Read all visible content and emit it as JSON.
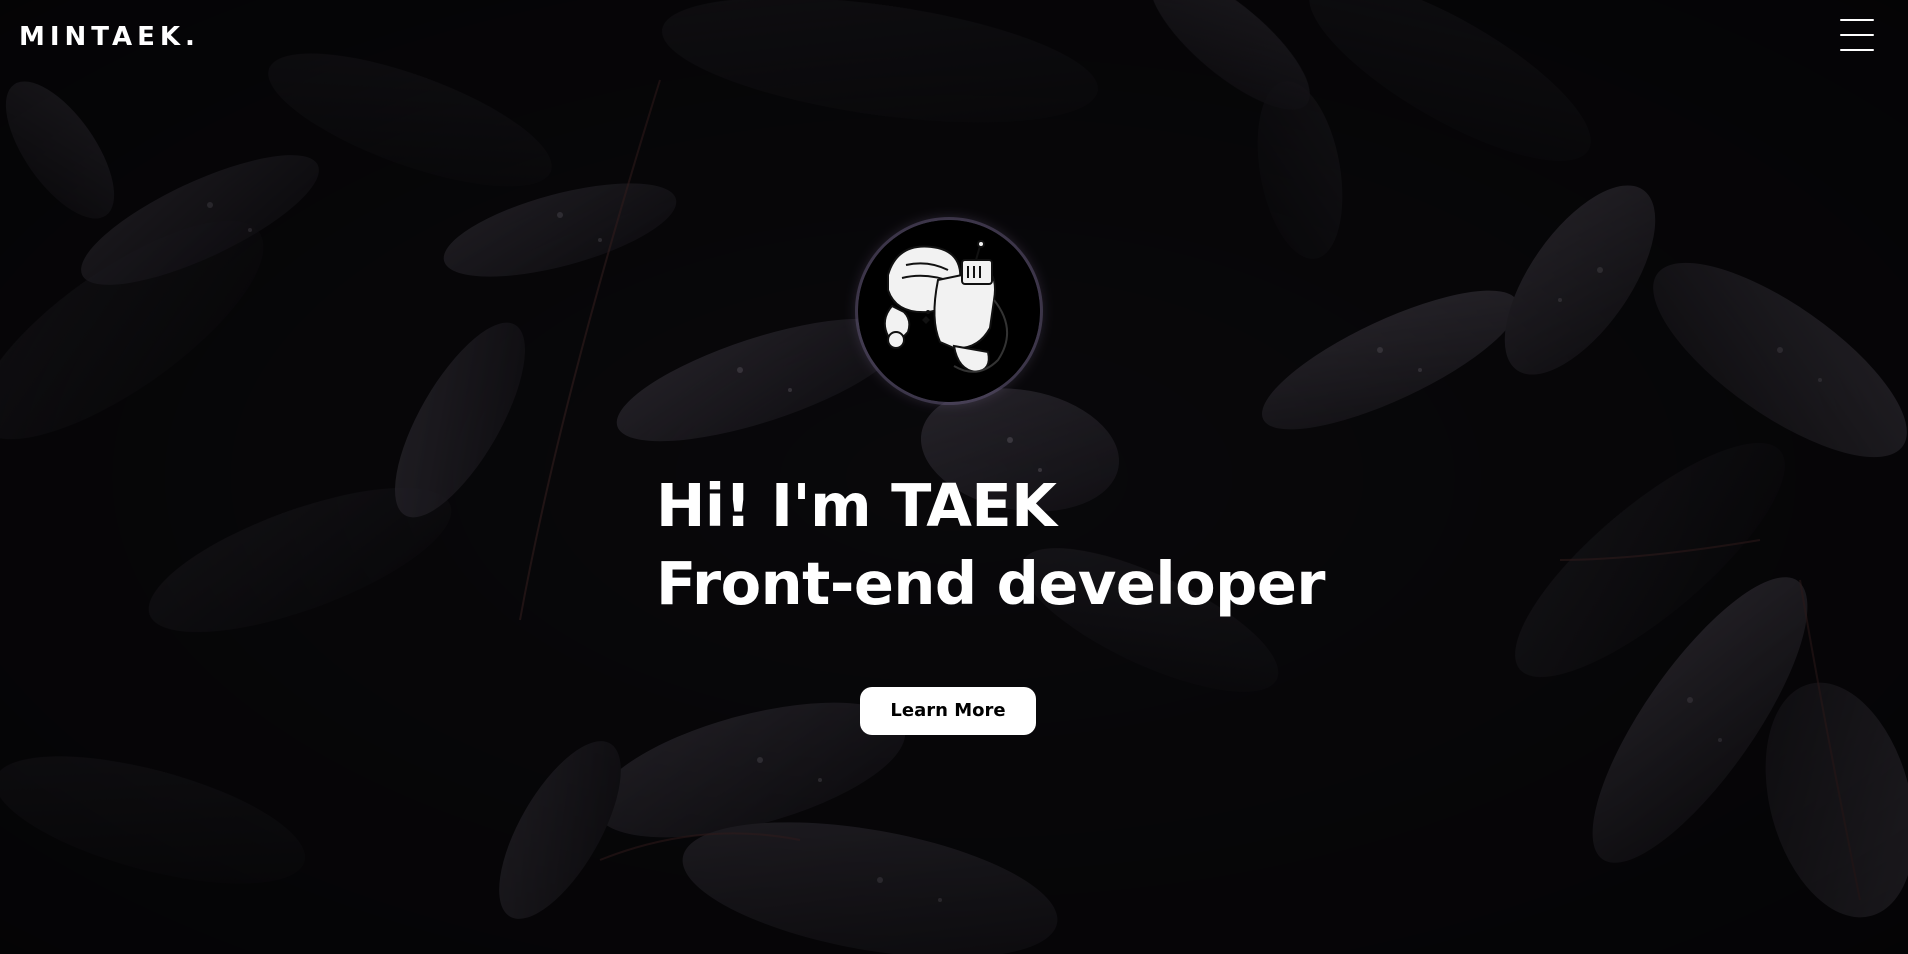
{
  "navbar": {
    "logo": "MINTAEK.",
    "menu_icon": "hamburger-menu-icon"
  },
  "hero": {
    "avatar_icon": "astronaut-avatar-icon",
    "headline_line1": "Hi! I'm TAEK",
    "headline_line2": "Front-end developer",
    "cta_label": "Learn More"
  },
  "background": {
    "description_icon": "dark-leaves-background",
    "color": "#0a090c"
  },
  "colors": {
    "text": "#ffffff",
    "button_bg": "#ffffff",
    "button_text": "#000000"
  }
}
